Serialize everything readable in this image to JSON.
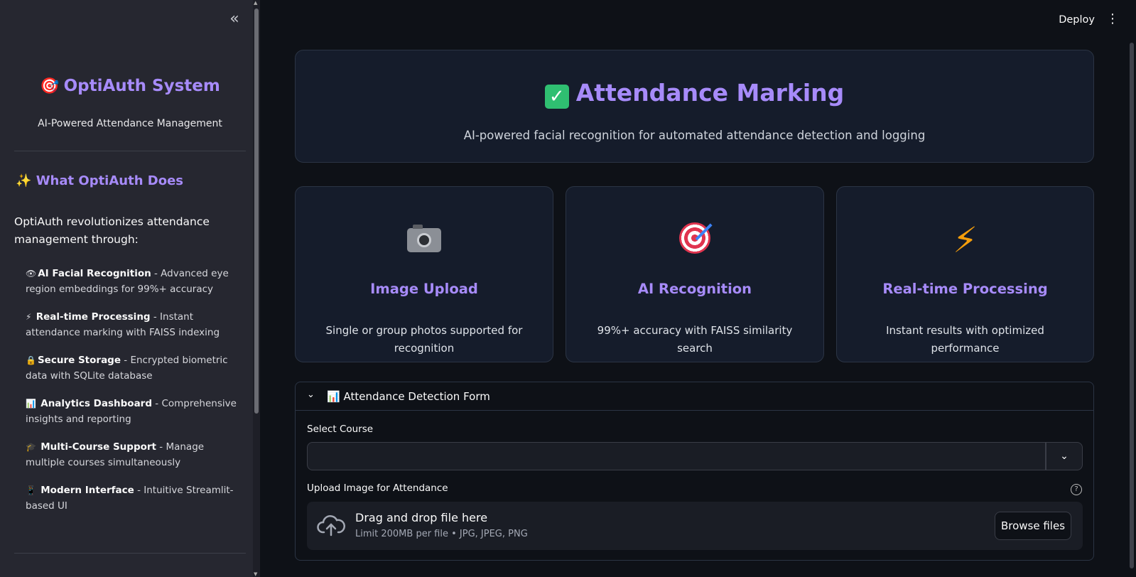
{
  "sidebar": {
    "collapse_glyph": "«",
    "brand_emoji": "🎯",
    "brand_title": "OptiAuth System",
    "brand_subtitle": "AI-Powered Attendance Management",
    "section_emoji": "✨",
    "section_title": "What OptiAuth Does",
    "intro": "OptiAuth revolutionizes attendance management through:",
    "features": [
      {
        "icon": "👁",
        "title": "AI Facial Recognition",
        "desc": " - Advanced eye region embeddings for 99%+ accuracy"
      },
      {
        "icon": "⚡",
        "title": "Real-time Processing",
        "desc": " - Instant attendance marking with FAISS indexing"
      },
      {
        "icon": "🔒",
        "title": "Secure Storage",
        "desc": " - Encrypted biometric data with SQLite database"
      },
      {
        "icon": "📊",
        "title": "Analytics Dashboard",
        "desc": " - Comprehensive insights and reporting"
      },
      {
        "icon": "🎓",
        "title": "Multi-Course Support",
        "desc": " - Manage multiple courses simultaneously"
      },
      {
        "icon": "📱",
        "title": "Modern Interface",
        "desc": " - Intuitive Streamlit-based UI"
      }
    ]
  },
  "header": {
    "deploy_label": "Deploy",
    "menu_glyph": "⋮"
  },
  "hero": {
    "check_glyph": "✓",
    "title": "Attendance Marking",
    "subtitle": "AI-powered facial recognition for automated attendance detection and logging"
  },
  "cards": [
    {
      "icon": "camera-icon",
      "title": "Image Upload",
      "desc": "Single or group photos supported for recognition"
    },
    {
      "icon": "target-icon",
      "title": "AI Recognition",
      "desc": "99%+ accuracy with FAISS similarity search"
    },
    {
      "icon": "lightning-icon",
      "title": "Real-time Processing",
      "desc": "Instant results with optimized performance"
    }
  ],
  "bolt_glyph": "⚡",
  "form": {
    "expander_icon": "📊",
    "expander_label": "Attendance Detection Form",
    "course_label": "Select Course",
    "course_value": "",
    "upload_label": "Upload Image for Attendance",
    "help_glyph": "?",
    "dropzone_title": "Drag and drop file here",
    "dropzone_limit": "Limit 200MB per file • JPG, JPEG, PNG",
    "browse_label": "Browse files"
  },
  "colors": {
    "accent": "#a78bfa",
    "background": "#0e1117",
    "sidebar": "#262730",
    "card": "#151c2b"
  }
}
